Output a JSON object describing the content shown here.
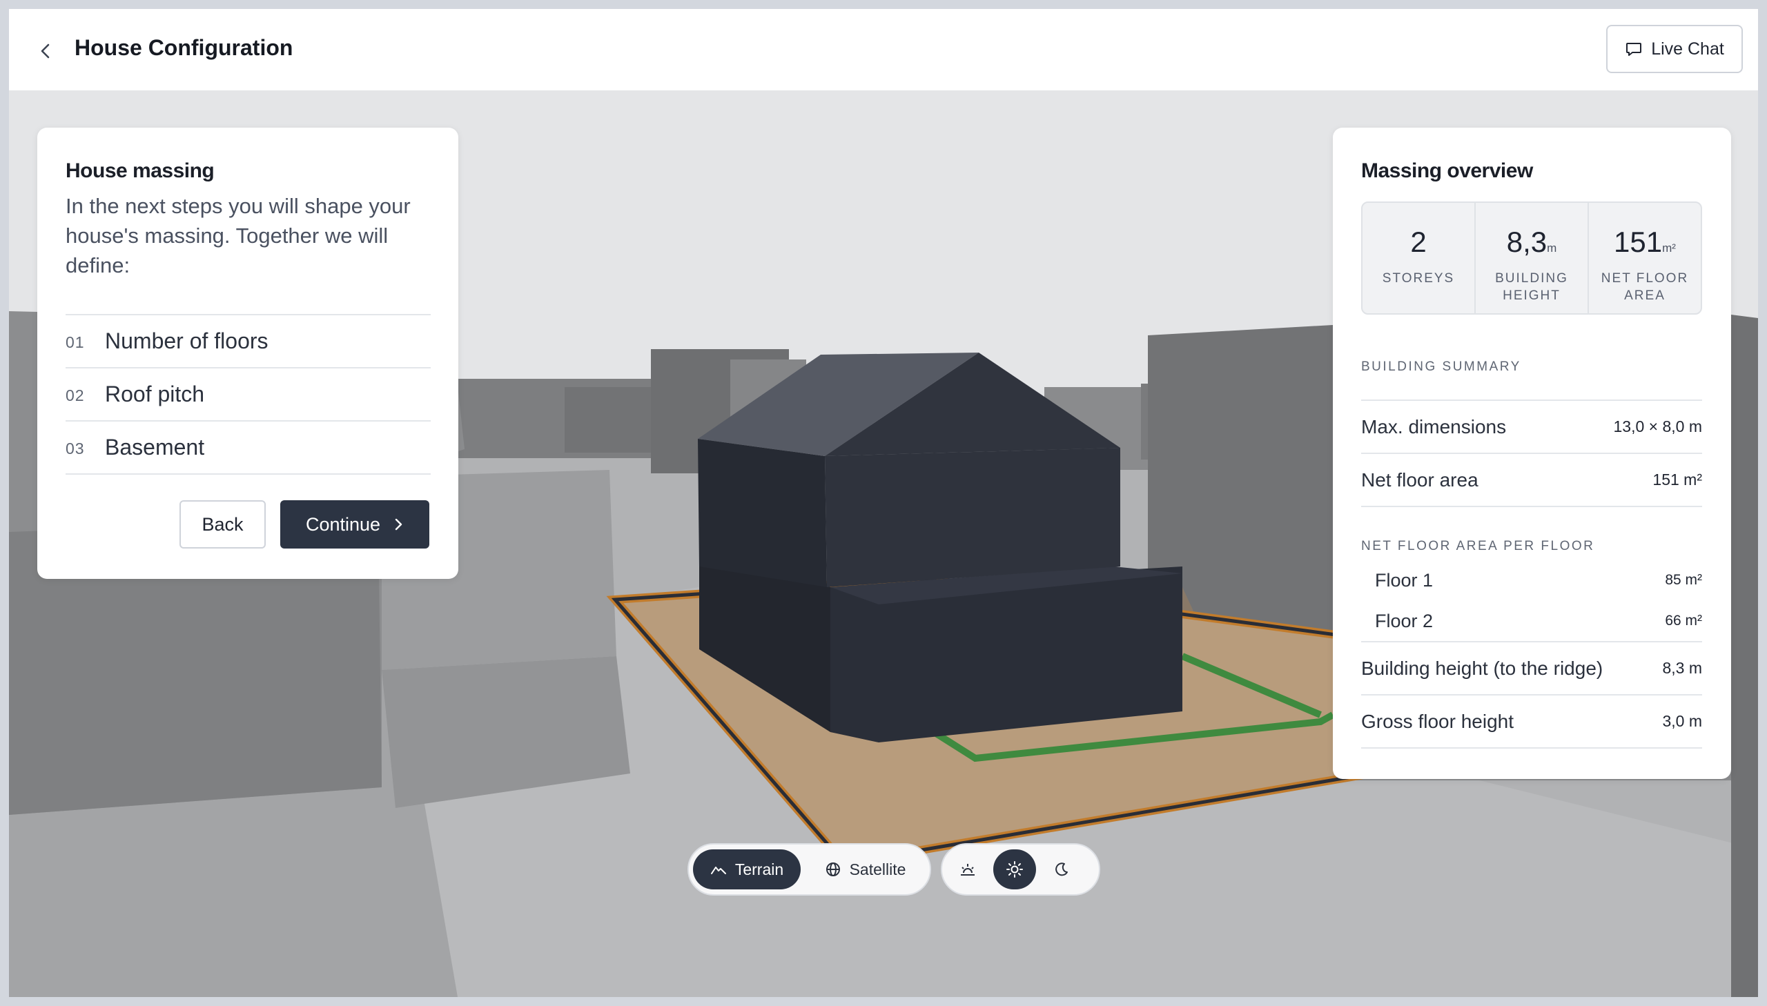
{
  "header": {
    "title": "House Configuration",
    "live_chat_label": "Live Chat"
  },
  "left_panel": {
    "title": "House massing",
    "description": "In the next steps you will shape your house's massing. Together we will define:",
    "steps": [
      {
        "num": "01",
        "label": "Number of floors"
      },
      {
        "num": "02",
        "label": "Roof pitch"
      },
      {
        "num": "03",
        "label": "Basement"
      }
    ],
    "back_label": "Back",
    "continue_label": "Continue"
  },
  "right_panel": {
    "title": "Massing overview",
    "stats": [
      {
        "value": "2",
        "unit": "",
        "label_line1": "STOREYS",
        "label_line2": ""
      },
      {
        "value": "8,3",
        "unit": "m",
        "label_line1": "BUILDING",
        "label_line2": "HEIGHT"
      },
      {
        "value": "151",
        "unit": "m²",
        "label_line1": "NET FLOOR",
        "label_line2": "AREA"
      }
    ],
    "summary_label": "BUILDING SUMMARY",
    "summary_rows": [
      {
        "label": "Max. dimensions",
        "value": "13,0 × 8,0 m"
      },
      {
        "label": "Net floor area",
        "value": "151 m²"
      }
    ],
    "per_floor_label": "NET FLOOR AREA PER FLOOR",
    "floors": [
      {
        "label": "Floor 1",
        "value": "85 m²"
      },
      {
        "label": "Floor 2",
        "value": "66 m²"
      }
    ],
    "bottom_rows": [
      {
        "label": "Building height (to the ridge)",
        "value": "8,3 m"
      },
      {
        "label": "Gross floor height",
        "value": "3,0 m"
      }
    ]
  },
  "map_controls": {
    "terrain_label": "Terrain",
    "satellite_label": "Satellite",
    "active_view": "Terrain",
    "active_light": "midday"
  },
  "colors": {
    "accent_dark": "#2c3443",
    "plot_fill": "#b89c7c",
    "plot_outline": "#c27c2c",
    "setback_line": "#3f8a3f",
    "house": "#2a2e38"
  }
}
